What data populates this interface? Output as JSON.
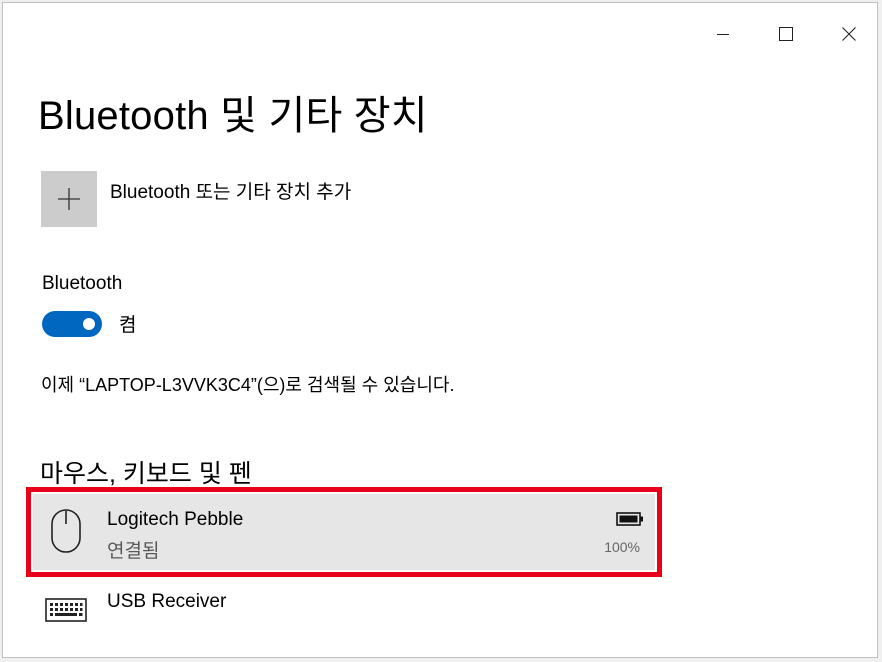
{
  "window": {
    "controls": [
      "minimize",
      "maximize",
      "close"
    ]
  },
  "page": {
    "title": "Bluetooth 및 기타 장치"
  },
  "add_device": {
    "icon": "plus-icon",
    "label": "Bluetooth 또는 기타 장치 추가"
  },
  "bluetooth": {
    "heading": "Bluetooth",
    "toggle_state": "켬",
    "toggle_on": true,
    "accent_color": "#0067c0",
    "discoverable_text": "이제 “LAPTOP-L3VVK3C4”(으)로 검색될 수 있습니다."
  },
  "section": {
    "heading": "마우스, 키보드 및 펜",
    "devices": [
      {
        "name": "Logitech Pebble",
        "status": "연결됨",
        "battery": "100%",
        "battery_level": 1.0,
        "icon": "mouse-icon",
        "selected": true,
        "highlight_color": "#e8001a"
      },
      {
        "name": "USB Receiver",
        "icon": "keyboard-icon",
        "selected": false
      }
    ]
  }
}
